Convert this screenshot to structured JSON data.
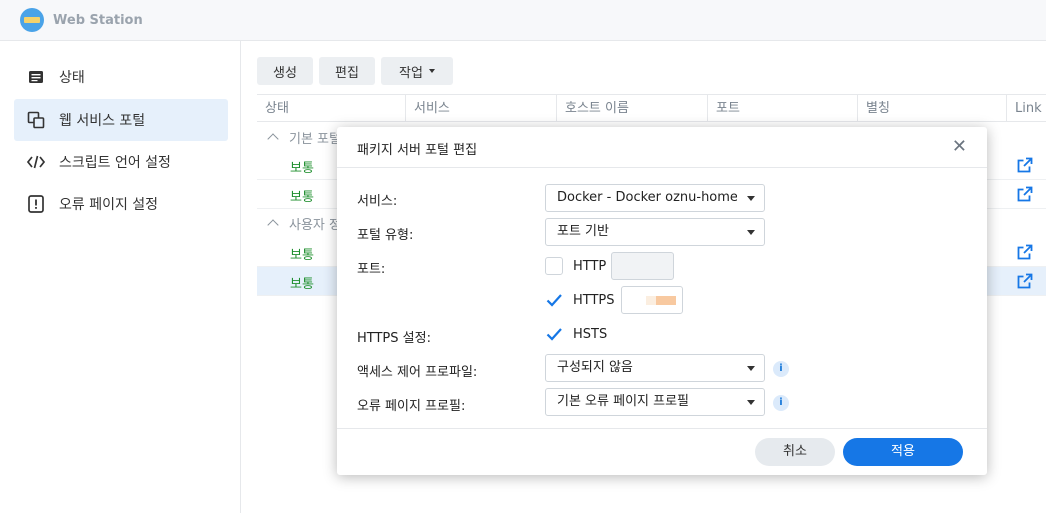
{
  "app": {
    "title": "Web Station"
  },
  "sidebar": {
    "items": [
      {
        "label": "상태",
        "icon": "status-list-icon"
      },
      {
        "label": "웹 서비스 포털",
        "icon": "portal-windows-icon"
      },
      {
        "label": "스크립트 언어 설정",
        "icon": "code-icon"
      },
      {
        "label": "오류 페이지 설정",
        "icon": "alert-icon"
      }
    ],
    "active_index": 1
  },
  "toolbar": {
    "create": "생성",
    "edit": "편집",
    "action": "작업"
  },
  "table": {
    "columns": [
      "상태",
      "서비스",
      "호스트 이름",
      "포트",
      "별칭",
      "Link"
    ],
    "groups": [
      "기본 포털",
      "사용자 정"
    ],
    "rows": [
      {
        "status": "보통",
        "selected": false
      },
      {
        "status": "보통",
        "selected": false
      },
      {
        "status": "보통",
        "selected": false
      },
      {
        "status": "보통",
        "selected": true
      }
    ]
  },
  "modal": {
    "title": "패키지 서버 포털 편집",
    "labels": {
      "service": "서비스:",
      "portal_type": "포털 유형:",
      "port": "포트:",
      "https_settings": "HTTPS 설정:",
      "access_profile": "액세스 제어 프로파일:",
      "error_profile": "오류 페이지 프로필:"
    },
    "service_value": "Docker - Docker oznu-home",
    "portal_type_value": "포트 기반",
    "http": {
      "label": "HTTP",
      "checked": false,
      "value": ""
    },
    "https": {
      "label": "HTTPS",
      "checked": true,
      "value": ""
    },
    "hsts": {
      "label": "HSTS",
      "checked": true
    },
    "access_profile_value": "구성되지 않음",
    "error_profile_value": "기본 오류 페이지 프로필",
    "cancel": "취소",
    "apply": "적용"
  },
  "colors": {
    "accent": "#1677e6",
    "status_green": "#1f8f2e",
    "selected_bg": "#e6f0fb"
  }
}
